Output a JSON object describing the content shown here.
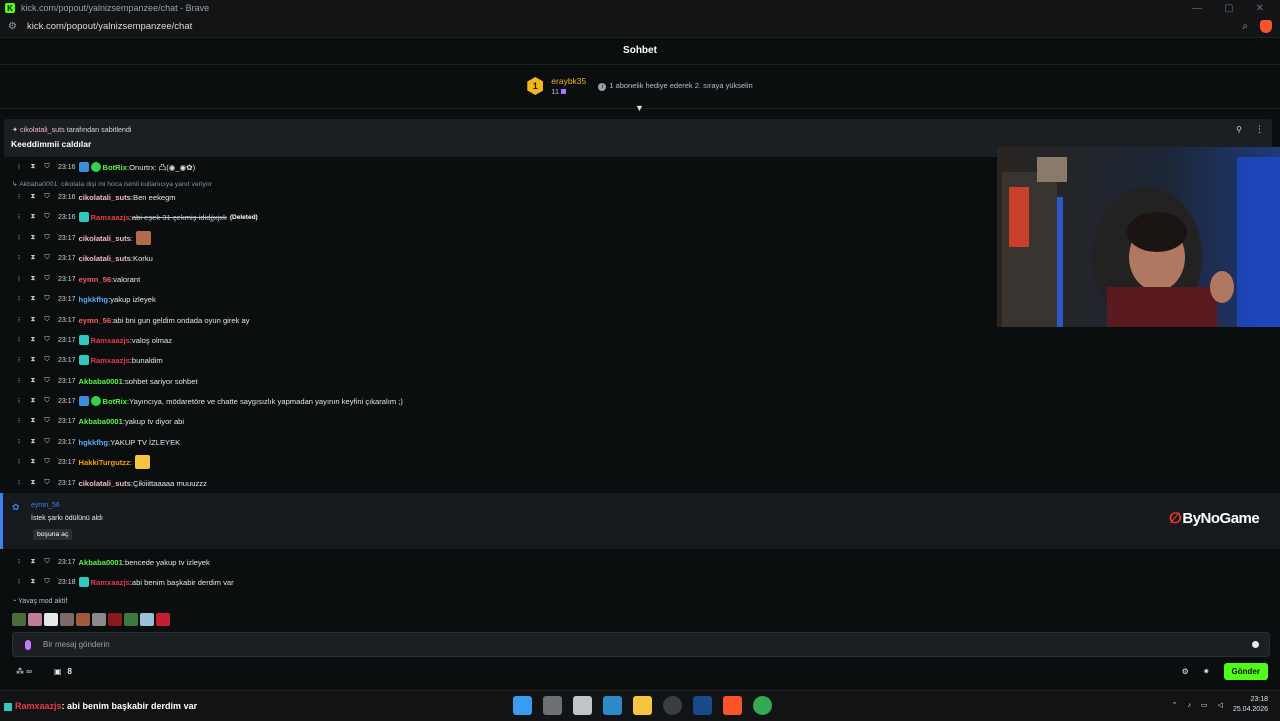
{
  "browser": {
    "window_title": "kick.com/popout/yalnizsempanzee/chat - Brave",
    "url": "kick.com/popout/yalnizsempanzee/chat"
  },
  "chat": {
    "title": "Sohbet",
    "leader": {
      "rank": "1",
      "username": "eraybk35",
      "count": "11",
      "hint": "1 abonelik hediye ederek 2. sıraya yükselin"
    },
    "pinned": {
      "by_user": "cikolatali_suts",
      "by_suffix": "tarafından sabitlendi",
      "text": "Keeddimmii caldılar"
    },
    "reply_context": "Akbaba0001: cikolata dişi mi hoca isimli kullanıcıya yanıt veriyor",
    "messages": [
      {
        "time": "23:16",
        "user": "BotRix",
        "color": "#5ef24a",
        "text": "Onurtrx: 凸(◉_◉✿)",
        "badges": [
          "b-blue",
          "b-green"
        ]
      },
      {
        "time": "23:16",
        "user": "cikolatali_suts",
        "color": "#f0b7c9",
        "text": "Ben eekegm",
        "badges": []
      },
      {
        "time": "23:16",
        "user": "Ramxaazjs",
        "color": "#e63946",
        "text": "abi eşek 31 çekmiş ididjjxjxk",
        "deleted": true,
        "tag": "(Deleted)",
        "badges": [
          "b-teal"
        ]
      },
      {
        "time": "23:17",
        "user": "cikolatali_suts",
        "color": "#f0b7c9",
        "text": "",
        "emote": "#b46a4a",
        "badges": []
      },
      {
        "time": "23:17",
        "user": "cikolatali_suts",
        "color": "#f0b7c9",
        "text": "Korku",
        "badges": []
      },
      {
        "time": "23:17",
        "user": "eymn_56",
        "color": "#ff5c5c",
        "text": "valorant",
        "badges": []
      },
      {
        "time": "23:17",
        "user": "hgkkfhg",
        "color": "#5aa9ff",
        "text": "yakup izleyek",
        "badges": []
      },
      {
        "time": "23:17",
        "user": "eymn_56",
        "color": "#ff5c5c",
        "text": "abi bni gun geldim ondada oyun girek ay",
        "badges": []
      },
      {
        "time": "23:17",
        "user": "Ramxaazjs",
        "color": "#e63946",
        "text": "valoş olmaz",
        "badges": [
          "b-teal"
        ]
      },
      {
        "time": "23:17",
        "user": "Ramxaazjs",
        "color": "#e63946",
        "text": "bunaldim",
        "badges": [
          "b-teal"
        ]
      },
      {
        "time": "23:17",
        "user": "Akbaba0001",
        "color": "#5ef24a",
        "text": "sohbet sariyor sohbet",
        "badges": []
      },
      {
        "time": "23:17",
        "user": "BotRix",
        "color": "#5ef24a",
        "text": "Yayıncıya, mödaretöre ve chatte saygısızlık yapmadan yayının keyfini çıkaralım ;)",
        "badges": [
          "b-blue",
          "b-green"
        ]
      },
      {
        "time": "23:17",
        "user": "Akbaba0001",
        "color": "#5ef24a",
        "text": "yakup tv diyor abi",
        "badges": []
      },
      {
        "time": "23:17",
        "user": "hgkkfhg",
        "color": "#5aa9ff",
        "text": "YAKUP TV İZLEYEK",
        "badges": []
      },
      {
        "time": "23:17",
        "user": "HakkiTurgutzz",
        "color": "#f59e0b",
        "text": "",
        "emote": "#f5c542",
        "badges": []
      },
      {
        "time": "23:17",
        "user": "cikolatali_suts",
        "color": "#f0b7c9",
        "text": "Çikiiittaaaaa muuuzzz",
        "badges": []
      },
      {
        "time": "23:17",
        "user": "Akbaba0001",
        "color": "#5ef24a",
        "text": "bencede yakup tv izleyek",
        "badges": []
      },
      {
        "time": "23:18",
        "user": "Ramxaazjs",
        "color": "#e63946",
        "text": "abi benim başkabir derdim var",
        "badges": [
          "b-teal"
        ]
      }
    ],
    "reward": {
      "user": "eymn_56",
      "title": "İstek şarkı ödülünü aldı",
      "value": "boşuna aç"
    },
    "watermark": "ByNoGame",
    "slow_mode": "Yavaş mod aktif",
    "input_placeholder": "Bir mesaj gönderin",
    "points": "∞",
    "gift_count": "8",
    "send_label": "Gönder"
  },
  "taskbar": {
    "notification_user": "Ramxaazjs",
    "notification_text": ": abi benim başkabir derdim var",
    "time": "23:18",
    "date": "25.04.2026"
  }
}
